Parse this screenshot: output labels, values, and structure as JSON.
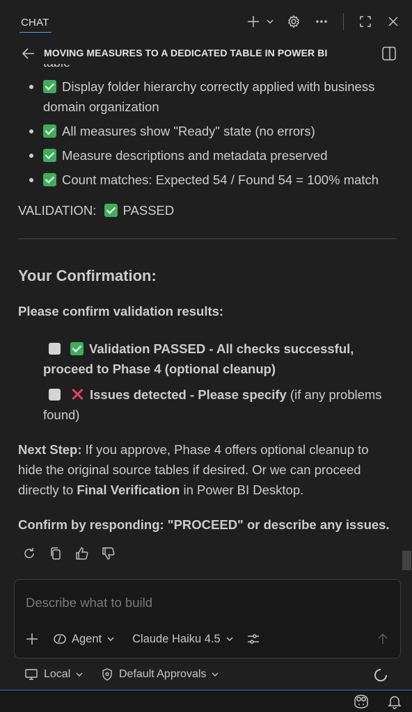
{
  "header": {
    "tab_label": "CHAT",
    "icons": [
      "plus-icon",
      "chevron-down-icon",
      "gear-icon",
      "more-icon",
      "maximize-icon",
      "close-icon"
    ]
  },
  "title_bar": {
    "title": "MOVING MEASURES TO A DEDICATED TABLE IN POWER BI",
    "icons": [
      "back-arrow-icon",
      "layout-panel-icon"
    ]
  },
  "message": {
    "clipped_text": "table",
    "bullets": [
      "Display folder hierarchy correctly applied with business domain organization",
      "All measures show \"Ready\" state (no errors)",
      "Measure descriptions and metadata preserved",
      "Count matches: Expected 54 / Found 54 = 100% match"
    ],
    "validation_label": "VALIDATION:",
    "validation_status": "PASSED",
    "confirmation_heading": "Your Confirmation:",
    "confirm_lead": "Please confirm validation results:",
    "option1_bold": "Validation PASSED - All checks successful, proceed to Phase 4 (optional cleanup)",
    "option2_bold": "Issues detected - Please specify",
    "option2_rest": " (if any problems found)",
    "next_step_label": "Next Step:",
    "next_step_text1": " If you approve, Phase 4 offers optional cleanup to hide the original source tables if desired. Or we can proceed directly to ",
    "next_step_bold": "Final Verification",
    "next_step_text2": " in Power BI Desktop.",
    "confirm_by": "Confirm by responding: \"PROCEED\" or describe any issues."
  },
  "composer": {
    "placeholder": "Describe what to build",
    "mode_label": "Agent",
    "model_label": "Claude Haiku 4.5"
  },
  "bottom_bar": {
    "location_label": "Local",
    "approvals_label": "Default Approvals"
  },
  "colors": {
    "accent": "#2a6fd6",
    "check_green": "#3fae5a",
    "cross_red": "#e5405e",
    "background": "#1f1f1f"
  }
}
